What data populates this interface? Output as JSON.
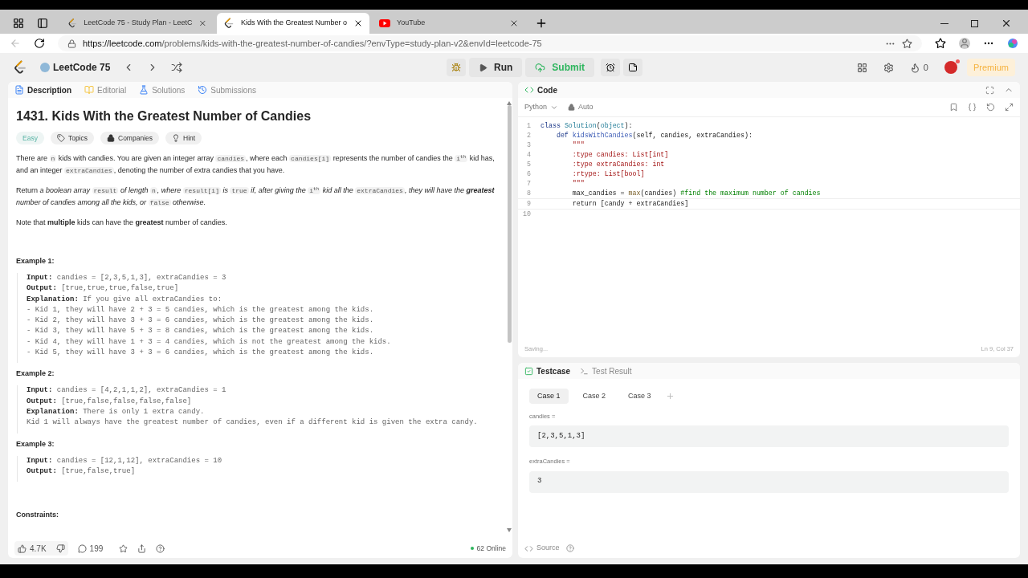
{
  "browser": {
    "tabs": [
      {
        "title": "LeetCode 75 - Study Plan - LeetC",
        "kind": "leetcode",
        "selected": false
      },
      {
        "title": "Kids With the Greatest Number o",
        "kind": "leetcode",
        "selected": true
      },
      {
        "title": "YouTube",
        "kind": "youtube",
        "selected": false
      }
    ],
    "url_host": "https://leetcode.com",
    "url_path": "/problems/kids-with-the-greatest-number-of-candies/?envType=study-plan-v2&envId=leetcode-75"
  },
  "nav": {
    "list_name": "LeetCode 75",
    "run": "Run",
    "submit": "Submit",
    "streak": "0",
    "premium": "Premium"
  },
  "description_panel": {
    "tabs": [
      {
        "label": "Description",
        "selected": true
      },
      {
        "label": "Editorial",
        "selected": false
      },
      {
        "label": "Solutions",
        "selected": false
      },
      {
        "label": "Submissions",
        "selected": false
      }
    ],
    "title": "1431. Kids With the Greatest Number of Candies",
    "tags": [
      {
        "label": "Easy",
        "kind": "difficulty"
      },
      {
        "label": "Topics",
        "kind": "topics"
      },
      {
        "label": "Companies",
        "kind": "companies"
      },
      {
        "label": "Hint",
        "kind": "hint"
      }
    ],
    "paragraphs": [
      [
        {
          "kind": "text",
          "text": "There are "
        },
        {
          "kind": "code",
          "text": "n"
        },
        {
          "kind": "text",
          "text": " kids with candies. You are given an integer array "
        },
        {
          "kind": "code",
          "text": "candies"
        },
        {
          "kind": "text",
          "text": ", where each "
        },
        {
          "kind": "code",
          "text": "candies[i]"
        },
        {
          "kind": "text",
          "text": " represents the number of candies the "
        },
        {
          "kind": "code",
          "text": "i$^{th}$"
        },
        {
          "kind": "text",
          "text": " kid has, and an integer "
        },
        {
          "kind": "code",
          "text": "extraCandies"
        },
        {
          "kind": "text",
          "text": ", denoting the number of extra candies that you have."
        }
      ],
      [
        {
          "kind": "text",
          "text": "Return "
        },
        {
          "kind": "em",
          "text": "a boolean array "
        },
        {
          "kind": "code",
          "text": "result"
        },
        {
          "kind": "em",
          "text": " of length "
        },
        {
          "kind": "code",
          "text": "n"
        },
        {
          "kind": "em",
          "text": ", where "
        },
        {
          "kind": "code",
          "text": "result[i]"
        },
        {
          "kind": "em",
          "text": " is "
        },
        {
          "kind": "code",
          "text": "true"
        },
        {
          "kind": "em",
          "text": " if, after giving the "
        },
        {
          "kind": "code",
          "text": "i$^{th}$"
        },
        {
          "kind": "em",
          "text": " kid all the "
        },
        {
          "kind": "code",
          "text": "extraCandies"
        },
        {
          "kind": "em",
          "text": ", they will have the **greatest** number of candies among all the kids, or "
        },
        {
          "kind": "code",
          "text": "false"
        },
        {
          "kind": "em",
          "text": " otherwise."
        }
      ],
      [
        {
          "kind": "text",
          "text": "Note that **multiple** kids can have the **greatest** number of candies."
        }
      ]
    ],
    "examples": [
      {
        "title": "Example 1:",
        "lines": [
          {
            "label": "Input:",
            "text": "candies = [2,3,5,1,3], extraCandies = 3"
          },
          {
            "label": "Output:",
            "text": "[true,true,true,false,true]"
          },
          {
            "label": "Explanation:",
            "text": "If you give all extraCandies to:"
          },
          {
            "text": "- Kid 1, they will have 2 + 3 = 5 candies, which is the greatest among the kids."
          },
          {
            "text": "- Kid 2, they will have 3 + 3 = 6 candies, which is the greatest among the kids."
          },
          {
            "text": "- Kid 3, they will have 5 + 3 = 8 candies, which is the greatest among the kids."
          },
          {
            "text": "- Kid 4, they will have 1 + 3 = 4 candies, which is not the greatest among the kids."
          },
          {
            "text": "- Kid 5, they will have 3 + 3 = 6 candies, which is the greatest among the kids."
          }
        ]
      },
      {
        "title": "Example 2:",
        "lines": [
          {
            "label": "Input:",
            "text": "candies = [4,2,1,1,2], extraCandies = 1"
          },
          {
            "label": "Output:",
            "text": "[true,false,false,false,false]"
          },
          {
            "label": "Explanation:",
            "text": "There is only 1 extra candy."
          },
          {
            "text": "Kid 1 will always have the greatest number of candies, even if a different kid is given the extra candy."
          }
        ]
      },
      {
        "title": "Example 3:",
        "lines": [
          {
            "label": "Input:",
            "text": "candies = [12,1,12], extraCandies = 10"
          },
          {
            "label": "Output:",
            "text": "[true,false,true]"
          }
        ]
      }
    ],
    "constraints_title": "Constraints:",
    "footer": {
      "likes": "4.7K",
      "comments": "199",
      "online": "62 Online"
    }
  },
  "code_panel": {
    "title": "Code",
    "language": "Python",
    "mode": "Auto",
    "lines": [
      {
        "number": "1",
        "tokens": [
          {
            "text": "class ",
            "kind": "kw"
          },
          {
            "text": "Solution",
            "kind": "type"
          },
          {
            "text": "(",
            "kind": "plain"
          },
          {
            "text": "object",
            "kind": "type"
          },
          {
            "text": "):",
            "kind": "plain"
          }
        ]
      },
      {
        "number": "2",
        "tokens": [
          {
            "text": "    def ",
            "kind": "kw"
          },
          {
            "text": "kidsWithCandies",
            "kind": "fn"
          },
          {
            "text": "(self, candies, extraCandies):",
            "kind": "plain"
          }
        ]
      },
      {
        "number": "3",
        "tokens": [
          {
            "text": "        \"\"\"",
            "kind": "str"
          }
        ]
      },
      {
        "number": "4",
        "tokens": [
          {
            "text": "        :type candies: List[int]",
            "kind": "str"
          }
        ]
      },
      {
        "number": "5",
        "tokens": [
          {
            "text": "        :type extraCandies: int",
            "kind": "str"
          }
        ]
      },
      {
        "number": "6",
        "tokens": [
          {
            "text": "        :rtype: List[bool]",
            "kind": "str"
          }
        ]
      },
      {
        "number": "7",
        "tokens": [
          {
            "text": "        \"\"\"",
            "kind": "str"
          }
        ]
      },
      {
        "number": "8",
        "tokens": [
          {
            "text": "        max_candies = ",
            "kind": "plain"
          },
          {
            "text": "max",
            "kind": "builtin"
          },
          {
            "text": "(candies) ",
            "kind": "plain"
          },
          {
            "text": "#find the maximum number of candies",
            "kind": "comment"
          }
        ]
      },
      {
        "number": "9",
        "tokens": [
          {
            "text": "        return [candy + extraCandies]",
            "kind": "plain"
          }
        ]
      },
      {
        "number": "10"
      }
    ],
    "status": "Saving...",
    "cursor": "Ln 9, Col 37"
  },
  "testcase_panel": {
    "tabs": [
      {
        "label": "Testcase",
        "selected": true
      },
      {
        "label": "Test Result",
        "selected": false
      }
    ],
    "cases": [
      {
        "label": "Case 1",
        "selected": true
      },
      {
        "label": "Case 2",
        "selected": false
      },
      {
        "label": "Case 3",
        "selected": false
      }
    ],
    "params": [
      {
        "name": "candies =",
        "value": "[2,3,5,1,3]"
      },
      {
        "name": "extraCandies =",
        "value": "3"
      }
    ],
    "source": "Source"
  }
}
